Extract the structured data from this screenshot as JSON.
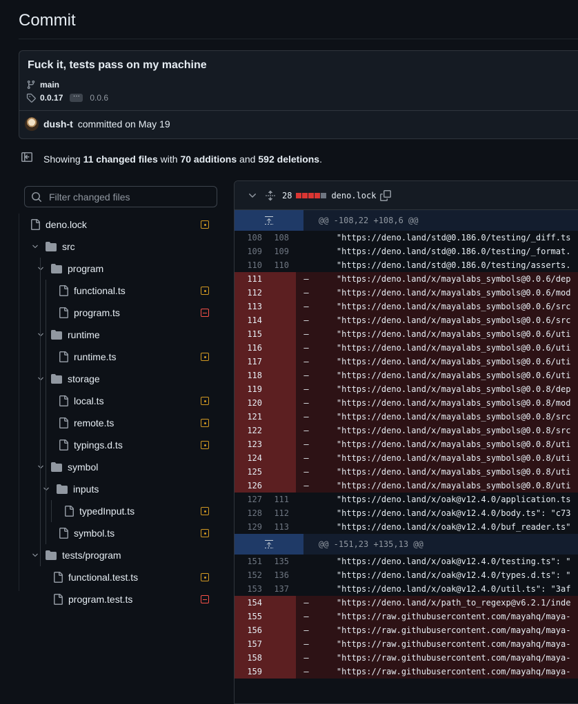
{
  "page": {
    "title": "Commit"
  },
  "commit": {
    "message": "Fuck it, tests pass on my machine",
    "branch": "main",
    "tag": "0.0.17",
    "tag_ellipsis": "···",
    "tag_other": "0.0.6",
    "author": "dush-t",
    "committed_text": "committed on May 19"
  },
  "summary": {
    "prefix": "Showing",
    "files": "11 changed files",
    "with": "with",
    "additions": "70 additions",
    "and": "and",
    "deletions": "592 deletions",
    "suffix": "."
  },
  "filter": {
    "placeholder": "Filter changed files"
  },
  "file_tree": [
    {
      "type": "file",
      "label": "deno.lock",
      "depth": 0,
      "status": "modified"
    },
    {
      "type": "dir",
      "label": "src",
      "depth": 0
    },
    {
      "type": "dir",
      "label": "program",
      "depth": 1
    },
    {
      "type": "file",
      "label": "functional.ts",
      "depth": 2,
      "status": "modified"
    },
    {
      "type": "file",
      "label": "program.ts",
      "depth": 2,
      "status": "deleted"
    },
    {
      "type": "dir",
      "label": "runtime",
      "depth": 1
    },
    {
      "type": "file",
      "label": "runtime.ts",
      "depth": 2,
      "status": "modified"
    },
    {
      "type": "dir",
      "label": "storage",
      "depth": 1
    },
    {
      "type": "file",
      "label": "local.ts",
      "depth": 2,
      "status": "modified"
    },
    {
      "type": "file",
      "label": "remote.ts",
      "depth": 2,
      "status": "modified"
    },
    {
      "type": "file",
      "label": "typings.d.ts",
      "depth": 2,
      "status": "modified"
    },
    {
      "type": "dir",
      "label": "symbol",
      "depth": 1
    },
    {
      "type": "dir",
      "label": "inputs",
      "depth": 2
    },
    {
      "type": "file",
      "label": "typedInput.ts",
      "depth": 3,
      "status": "modified"
    },
    {
      "type": "file",
      "label": "symbol.ts",
      "depth": 2,
      "status": "modified"
    },
    {
      "type": "dir",
      "label": "tests/program",
      "depth": 0
    },
    {
      "type": "file",
      "label": "functional.test.ts",
      "depth": 1,
      "status": "modified"
    },
    {
      "type": "file",
      "label": "program.test.ts",
      "depth": 1,
      "status": "deleted"
    }
  ],
  "diff": {
    "change_count": "28",
    "file_name": "deno.lock",
    "colors": {
      "deleted": "#da3633",
      "neutral": "#6e7681"
    },
    "rows": [
      {
        "kind": "hunk",
        "text": "@@ -108,22 +108,6 @@"
      },
      {
        "kind": "ctx",
        "old": "108",
        "new": "108",
        "code": "    \"https://deno.land/std@0.186.0/testing/_diff.ts"
      },
      {
        "kind": "ctx",
        "old": "109",
        "new": "109",
        "code": "    \"https://deno.land/std@0.186.0/testing/_format."
      },
      {
        "kind": "ctx",
        "old": "110",
        "new": "110",
        "code": "    \"https://deno.land/std@0.186.0/testing/asserts."
      },
      {
        "kind": "del",
        "old": "111",
        "new": "",
        "code": "    \"https://deno.land/x/mayalabs_symbols@0.0.6/dep"
      },
      {
        "kind": "del",
        "old": "112",
        "new": "",
        "code": "    \"https://deno.land/x/mayalabs_symbols@0.0.6/mod"
      },
      {
        "kind": "del",
        "old": "113",
        "new": "",
        "code": "    \"https://deno.land/x/mayalabs_symbols@0.0.6/src"
      },
      {
        "kind": "del",
        "old": "114",
        "new": "",
        "code": "    \"https://deno.land/x/mayalabs_symbols@0.0.6/src"
      },
      {
        "kind": "del",
        "old": "115",
        "new": "",
        "code": "    \"https://deno.land/x/mayalabs_symbols@0.0.6/uti"
      },
      {
        "kind": "del",
        "old": "116",
        "new": "",
        "code": "    \"https://deno.land/x/mayalabs_symbols@0.0.6/uti"
      },
      {
        "kind": "del",
        "old": "117",
        "new": "",
        "code": "    \"https://deno.land/x/mayalabs_symbols@0.0.6/uti"
      },
      {
        "kind": "del",
        "old": "118",
        "new": "",
        "code": "    \"https://deno.land/x/mayalabs_symbols@0.0.6/uti"
      },
      {
        "kind": "del",
        "old": "119",
        "new": "",
        "code": "    \"https://deno.land/x/mayalabs_symbols@0.0.8/dep"
      },
      {
        "kind": "del",
        "old": "120",
        "new": "",
        "code": "    \"https://deno.land/x/mayalabs_symbols@0.0.8/mod"
      },
      {
        "kind": "del",
        "old": "121",
        "new": "",
        "code": "    \"https://deno.land/x/mayalabs_symbols@0.0.8/src"
      },
      {
        "kind": "del",
        "old": "122",
        "new": "",
        "code": "    \"https://deno.land/x/mayalabs_symbols@0.0.8/src"
      },
      {
        "kind": "del",
        "old": "123",
        "new": "",
        "code": "    \"https://deno.land/x/mayalabs_symbols@0.0.8/uti"
      },
      {
        "kind": "del",
        "old": "124",
        "new": "",
        "code": "    \"https://deno.land/x/mayalabs_symbols@0.0.8/uti"
      },
      {
        "kind": "del",
        "old": "125",
        "new": "",
        "code": "    \"https://deno.land/x/mayalabs_symbols@0.0.8/uti"
      },
      {
        "kind": "del",
        "old": "126",
        "new": "",
        "code": "    \"https://deno.land/x/mayalabs_symbols@0.0.8/uti"
      },
      {
        "kind": "ctx",
        "old": "127",
        "new": "111",
        "code": "    \"https://deno.land/x/oak@v12.4.0/application.ts"
      },
      {
        "kind": "ctx",
        "old": "128",
        "new": "112",
        "code": "    \"https://deno.land/x/oak@v12.4.0/body.ts\": \"c73"
      },
      {
        "kind": "ctx",
        "old": "129",
        "new": "113",
        "code": "    \"https://deno.land/x/oak@v12.4.0/buf_reader.ts\""
      },
      {
        "kind": "hunk",
        "text": "@@ -151,23 +135,13 @@"
      },
      {
        "kind": "ctx",
        "old": "151",
        "new": "135",
        "code": "    \"https://deno.land/x/oak@v12.4.0/testing.ts\": \""
      },
      {
        "kind": "ctx",
        "old": "152",
        "new": "136",
        "code": "    \"https://deno.land/x/oak@v12.4.0/types.d.ts\": \""
      },
      {
        "kind": "ctx",
        "old": "153",
        "new": "137",
        "code": "    \"https://deno.land/x/oak@v12.4.0/util.ts\": \"3af"
      },
      {
        "kind": "del",
        "old": "154",
        "new": "",
        "code": "    \"https://deno.land/x/path_to_regexp@v6.2.1/inde"
      },
      {
        "kind": "del",
        "old": "155",
        "new": "",
        "code": "    \"https://raw.githubusercontent.com/mayahq/maya-"
      },
      {
        "kind": "del",
        "old": "156",
        "new": "",
        "code": "    \"https://raw.githubusercontent.com/mayahq/maya-"
      },
      {
        "kind": "del",
        "old": "157",
        "new": "",
        "code": "    \"https://raw.githubusercontent.com/mayahq/maya-"
      },
      {
        "kind": "del",
        "old": "158",
        "new": "",
        "code": "    \"https://raw.githubusercontent.com/mayahq/maya-"
      },
      {
        "kind": "del",
        "old": "159",
        "new": "",
        "code": "    \"https://raw.githubusercontent.com/mayahq/maya-"
      }
    ]
  }
}
